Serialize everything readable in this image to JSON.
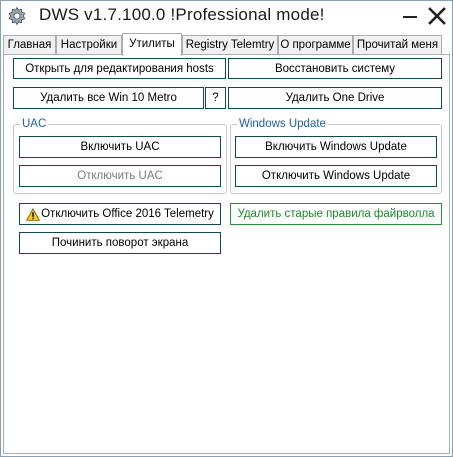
{
  "window": {
    "title": "DWS v1.7.100.0  !Professional mode!"
  },
  "tabs": [
    {
      "label": "Главная"
    },
    {
      "label": "Настройки"
    },
    {
      "label": "Утилиты"
    },
    {
      "label": "Registry Telemtry"
    },
    {
      "label": "О программе"
    },
    {
      "label": "Прочитай меня"
    }
  ],
  "active_tab": "Утилиты",
  "utilities": {
    "open_hosts": "Открыть для редактирования hosts",
    "restore_system": "Восстановить систему",
    "remove_metro": "Удалить все Win 10 Metro",
    "help": "?",
    "remove_onedrive": "Удалить One Drive",
    "uac": {
      "label": "UAC",
      "enable": "Включить UAC",
      "disable": "Отключить UAC"
    },
    "windows_update": {
      "label": "Windows Update",
      "enable": "Включить Windows Update",
      "disable": "Отключить Windows Update"
    },
    "office_telemetry": "Отключить Office 2016 Telemetry",
    "firewall_rules": "Удалить старые правила файрволла",
    "fix_rotation": "Починить поворот экрана"
  },
  "icons": {
    "app": "gear-icon",
    "minimize": "minimize-icon",
    "close": "close-icon",
    "warning": "warning-icon"
  },
  "colors": {
    "button_border": "#0f4c44",
    "group_label": "#1f5fa8",
    "green_text": "#1e8a2e",
    "disabled_text": "#7a7a7a"
  }
}
